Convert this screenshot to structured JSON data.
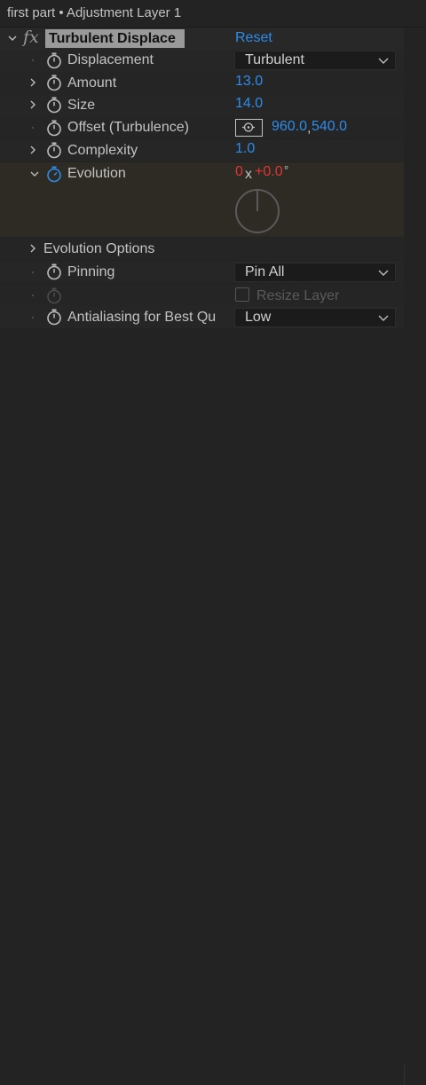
{
  "title": {
    "text": "first part • Adjustment Layer 1"
  },
  "effect": {
    "fx_symbol": "fx",
    "name": "Turbulent Displace",
    "reset_label": "Reset"
  },
  "properties": {
    "displacement": {
      "label": "Displacement",
      "value": "Turbulent"
    },
    "amount": {
      "label": "Amount",
      "value": "13.0"
    },
    "size": {
      "label": "Size",
      "value": "14.0"
    },
    "offset": {
      "label": "Offset (Turbulence)",
      "x": "960.0",
      "separator": ",",
      "y": "540.0"
    },
    "complexity": {
      "label": "Complexity",
      "value": "1.0"
    },
    "evolution": {
      "label": "Evolution",
      "revolutions": "0",
      "x_symbol": "x",
      "degrees": "+0.0",
      "degree_symbol": "°"
    },
    "evolution_options": {
      "label": "Evolution Options"
    },
    "pinning": {
      "label": "Pinning",
      "value": "Pin All"
    },
    "resize_layer": {
      "label": "Resize Layer",
      "checked": false
    },
    "antialiasing": {
      "label": "Antialiasing for Best Qu",
      "value": "Low"
    }
  },
  "colors": {
    "background": "#232323",
    "value_blue": "#2d8ceb",
    "keyframe_red": "#e03535",
    "label_gray": "#c3c3c3"
  },
  "icons": [
    "chevron-right-icon",
    "chevron-down-icon",
    "stopwatch-icon",
    "target-icon",
    "dial-icon"
  ]
}
